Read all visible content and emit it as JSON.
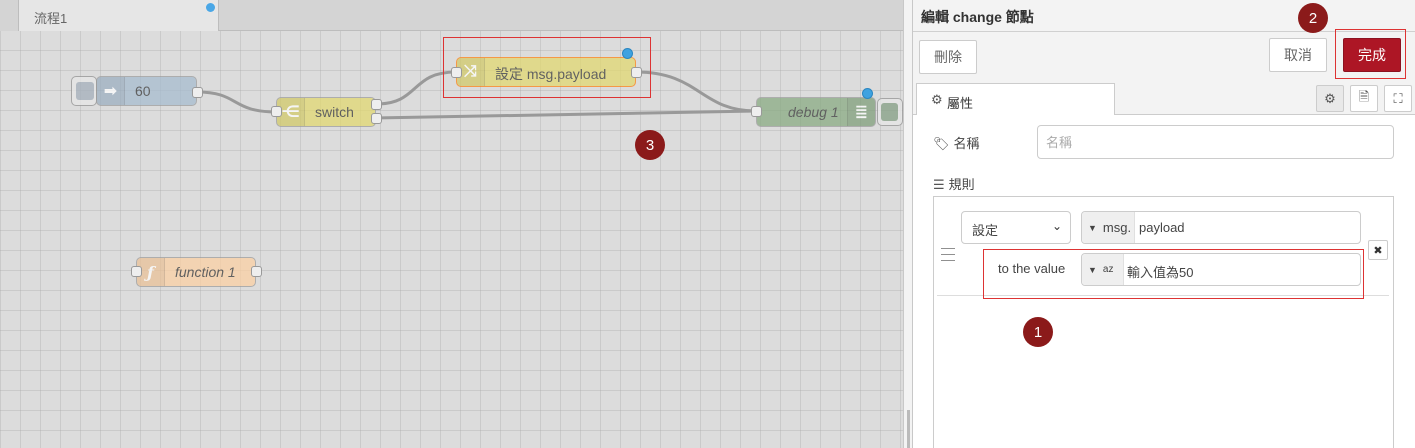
{
  "workspace": {
    "flow_tab_label": "流程1",
    "nodes": {
      "inject_label": "60",
      "switch_label": "switch",
      "change_label": "設定 msg.payload",
      "debug_label": "debug 1",
      "function_label": "function 1"
    }
  },
  "editor": {
    "title": "編輯 change 節點",
    "delete_label": "刪除",
    "cancel_label": "取消",
    "done_label": "完成",
    "tab_properties": "屬性",
    "name_label": "名稱",
    "name_placeholder": "名稱",
    "rules_label": "規則",
    "rule": {
      "action": "設定",
      "target_type": "msg.",
      "target_value": "payload",
      "to_label": "to the value",
      "value_type": "az",
      "value": "輸入值為50"
    }
  },
  "annotations": {
    "badge_1": "1",
    "badge_2": "2",
    "badge_3": "3"
  },
  "colors": {
    "done_button": "#ad1625",
    "badge": "#8b1a1a",
    "highlight": "#dd3333",
    "status_dot": "#3ea2e0"
  }
}
